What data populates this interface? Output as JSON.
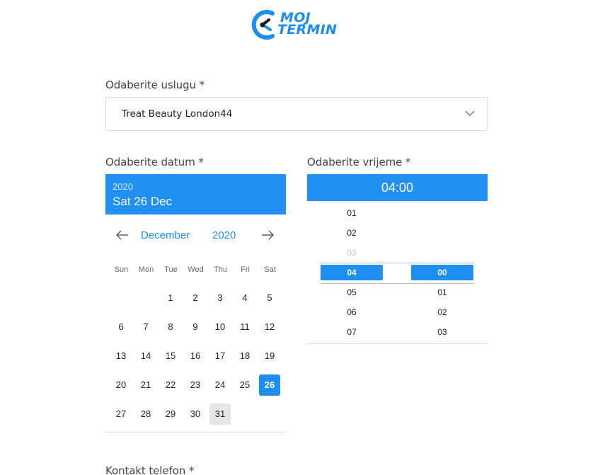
{
  "brand": {
    "line1": "MOJ",
    "line2": "TERMIN",
    "color": "#1b8ef0"
  },
  "service": {
    "label": "Odaberite uslugu *",
    "value": "Treat Beauty London44",
    "icon": "chevron-down-icon"
  },
  "date": {
    "label": "Odaberite datum *",
    "header_year": "2020",
    "header_full": "Sat 26 Dec",
    "month": "December",
    "year": "2020",
    "prev_icon": "arrow-left-icon",
    "next_icon": "arrow-right-icon",
    "weekdays": [
      "Sun",
      "Mon",
      "Tue",
      "Wed",
      "Thu",
      "Fri",
      "Sat"
    ],
    "weeks": [
      [
        "",
        "",
        "1",
        "2",
        "3",
        "4",
        "5"
      ],
      [
        "6",
        "7",
        "8",
        "9",
        "10",
        "11",
        "12"
      ],
      [
        "13",
        "14",
        "15",
        "16",
        "17",
        "18",
        "19"
      ],
      [
        "20",
        "21",
        "22",
        "23",
        "24",
        "25",
        "26"
      ],
      [
        "27",
        "28",
        "29",
        "30",
        "31",
        "",
        ""
      ]
    ],
    "selected_day": "26",
    "highlighted_day": "31"
  },
  "time": {
    "label": "Odaberite vrijeme *",
    "value": "04:00",
    "hours": [
      "01",
      "02",
      "03",
      "04",
      "05",
      "06",
      "07"
    ],
    "selected_hour": "04",
    "minutes": [
      "00",
      "01",
      "02",
      "03"
    ],
    "selected_minute": "00"
  },
  "contact": {
    "label": "Kontakt telefon *"
  },
  "colors": {
    "accent": "#1f8ef1",
    "header": "#2091f3"
  }
}
